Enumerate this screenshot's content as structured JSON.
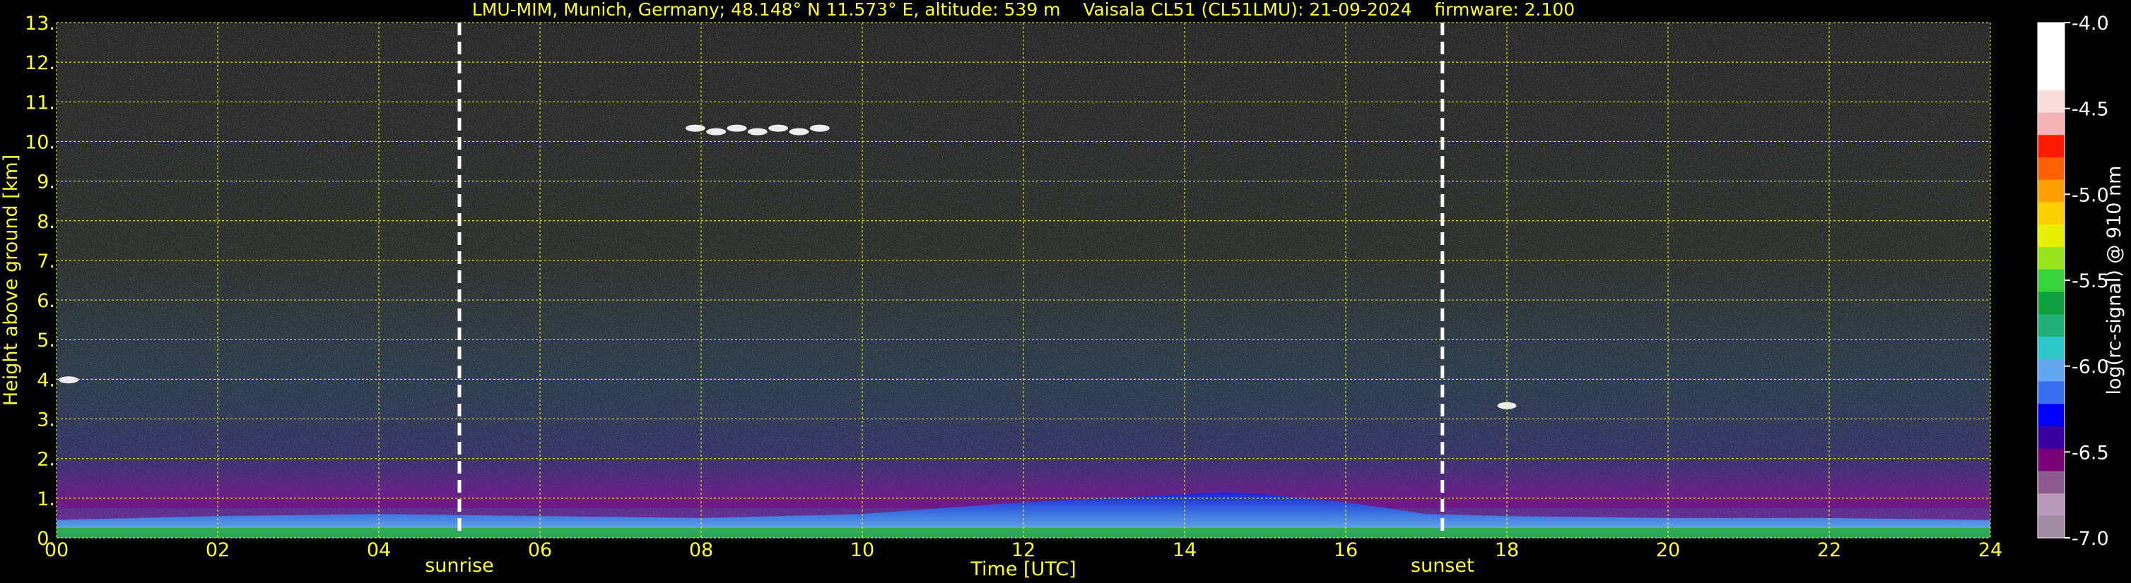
{
  "chart_data": {
    "type": "heatmap",
    "title": "LMU-MIM, Munich, Germany; 48.148° N 11.573° E, altitude: 539 m    Vaisala CL51 (CL51LMU): 21-09-2024    firmware: 2.100",
    "xlabel": "Time [UTC]",
    "ylabel": "Height above ground [km]",
    "xlim": [
      0,
      24
    ],
    "ylim": [
      0,
      13
    ],
    "x_ticks": [
      0,
      2,
      4,
      6,
      8,
      10,
      12,
      14,
      16,
      18,
      20,
      22,
      24
    ],
    "x_tick_labels": [
      "00",
      "02",
      "04",
      "06",
      "08",
      "10",
      "12",
      "14",
      "16",
      "18",
      "20",
      "22",
      "24"
    ],
    "y_ticks": [
      0,
      1,
      2,
      3,
      4,
      5,
      6,
      7,
      8,
      9,
      10,
      11,
      12,
      13
    ],
    "y_tick_labels": [
      "0.",
      "1.",
      "2.",
      "3.",
      "4.",
      "5.",
      "6.",
      "7.",
      "8.",
      "9.",
      "10.",
      "11.",
      "12.",
      "13."
    ],
    "grid": true,
    "colorbar": {
      "label": "log(rc-signal) @ 910 nm",
      "range": [
        -7.0,
        -4.0
      ],
      "tick_values": [
        -4.0,
        -4.5,
        -5.0,
        -5.5,
        -6.0,
        -6.5,
        -7.0
      ],
      "tick_labels": [
        "-4.0",
        "-4.5",
        "-5.0",
        "-5.5",
        "-6.0",
        "-6.5",
        "-7.0"
      ],
      "colors": [
        "#a08aa0",
        "#b898b8",
        "#8c5a8c",
        "#7a007a",
        "#3a00a0",
        "#0000ff",
        "#3a6ef0",
        "#62a6f0",
        "#2ec8c8",
        "#20b07a",
        "#10a040",
        "#3ad23a",
        "#9ae61e",
        "#e6f000",
        "#ffd000",
        "#ffa000",
        "#ff6000",
        "#ff1a00",
        "#f4b4b4",
        "#f8dcdc",
        "#ffffff",
        "#ffffff",
        "#ffffff"
      ]
    },
    "annotations": [
      {
        "label": "sunrise",
        "x": 5.0
      },
      {
        "label": "sunset",
        "x": 17.2
      }
    ],
    "boundary_layer_height_km": {
      "x": [
        0,
        2,
        4,
        6,
        8,
        10,
        11,
        12,
        13,
        14,
        14.5,
        15,
        16,
        17,
        18,
        20,
        22,
        24
      ],
      "y": [
        0.45,
        0.55,
        0.6,
        0.55,
        0.5,
        0.6,
        0.75,
        0.9,
        1.0,
        1.1,
        1.15,
        1.1,
        0.9,
        0.6,
        0.55,
        0.5,
        0.5,
        0.45
      ]
    },
    "cloud_features": [
      {
        "x_start": 7.8,
        "x_end": 9.6,
        "height_km": 10.3
      },
      {
        "x_start": 17.9,
        "x_end": 18.1,
        "height_km": 3.3
      },
      {
        "x_start": 0.0,
        "x_end": 0.3,
        "height_km": 3.95
      }
    ]
  },
  "colors": {
    "text": "#ffff33",
    "grid": "#ffff00",
    "background": "#000000"
  }
}
